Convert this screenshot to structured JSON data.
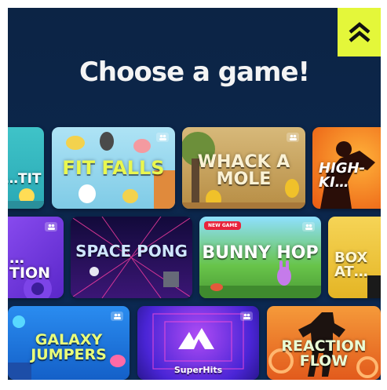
{
  "header": {
    "title": "Choose a game!"
  },
  "logo": {
    "icon": "double-chevron-up-icon",
    "color": "#e4f73a"
  },
  "rows": [
    [
      {
        "name": "…TIT",
        "bg": "#3fc3c8"
      },
      {
        "name": "FIT FALLS",
        "bg": "#8fd2ea"
      },
      {
        "name": "WHACK A MOLE",
        "bg": "#c9a25a"
      },
      {
        "name": "HIGH-KI…",
        "bg": "#f26a1b"
      }
    ],
    [
      {
        "name": "…TION",
        "bg": "#6f3be0"
      },
      {
        "name": "SPACE PONG",
        "bg": "#2a1460"
      },
      {
        "name": "BUNNY HOP",
        "bg": "#69c54b",
        "badge": "NEW GAME"
      },
      {
        "name": "BOX AT…",
        "bg": "#f0c431"
      }
    ],
    [
      {
        "name": "GALAXY JUMPERS",
        "bg": "#1f7fe6"
      },
      {
        "name": "SuperHits",
        "bg": "#5530d8"
      },
      {
        "name": "REACTION FLOW",
        "bg": "#f07c2c"
      }
    ]
  ],
  "icons": {
    "players": "players-icon"
  }
}
